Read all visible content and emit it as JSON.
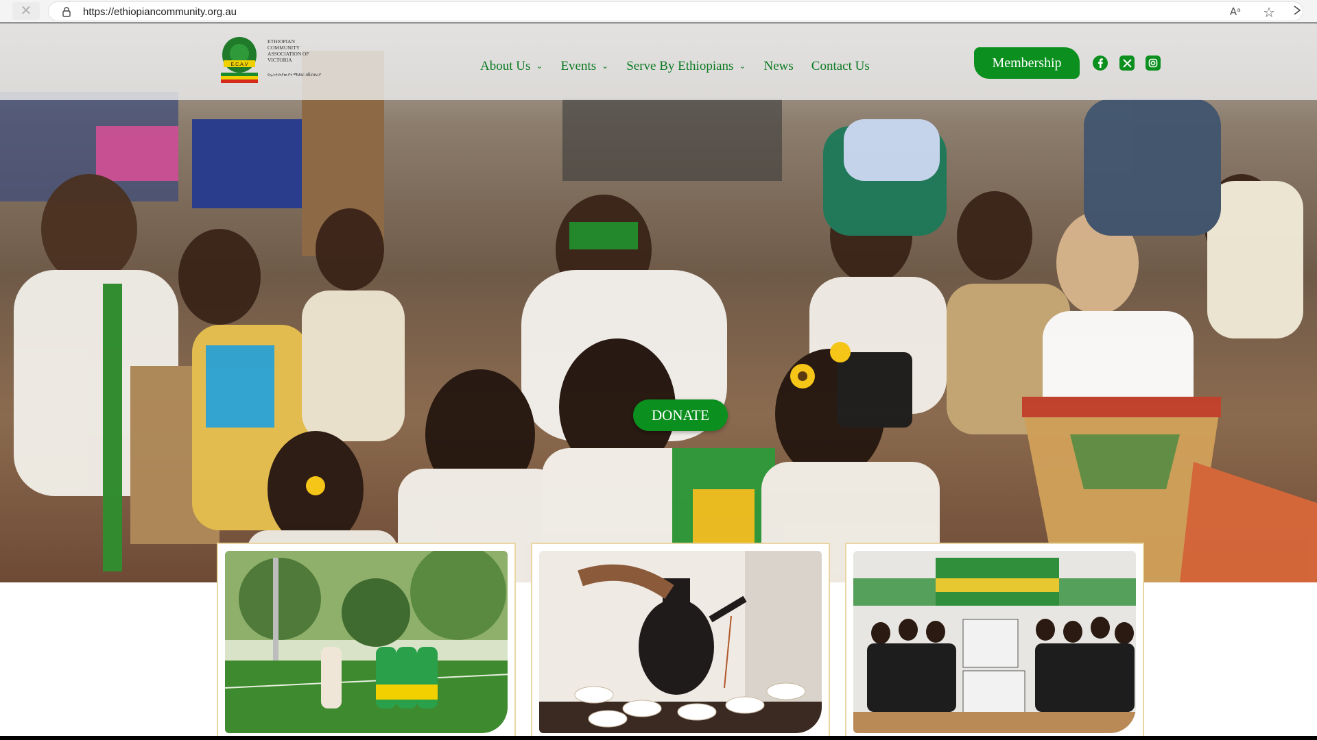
{
  "browser": {
    "url": "https://ethiopiancommunity.org.au",
    "close_glyph": "✕",
    "read_aloud_glyph": "Aᵃ",
    "favorite_glyph": "☆"
  },
  "header": {
    "logo_text": "ETHIOPIAN COMMUNITY ASSOCIATION OF VICTORIA",
    "logo_subtext": "የኢትዮጵያውያን ማህበር በቪክቶሪያ",
    "emblem_text": "E.C.A.V",
    "nav": [
      {
        "label": "About Us",
        "has_dropdown": true
      },
      {
        "label": "Events",
        "has_dropdown": true
      },
      {
        "label": "Serve By Ethiopians",
        "has_dropdown": true
      },
      {
        "label": "News",
        "has_dropdown": false
      },
      {
        "label": "Contact Us",
        "has_dropdown": false
      }
    ],
    "membership_label": "Membership",
    "social_icons": [
      "facebook-icon",
      "x-twitter-icon",
      "instagram-icon"
    ]
  },
  "hero": {
    "donate_label": "DONATE"
  },
  "cards": [
    {
      "image": "football-team-photo"
    },
    {
      "image": "coffee-ceremony-photo"
    },
    {
      "image": "community-gathering-photo"
    }
  ],
  "colors": {
    "brand_green": "#0b8f1e",
    "nav_green": "#0b7a22",
    "card_border": "#e9d6a3"
  }
}
